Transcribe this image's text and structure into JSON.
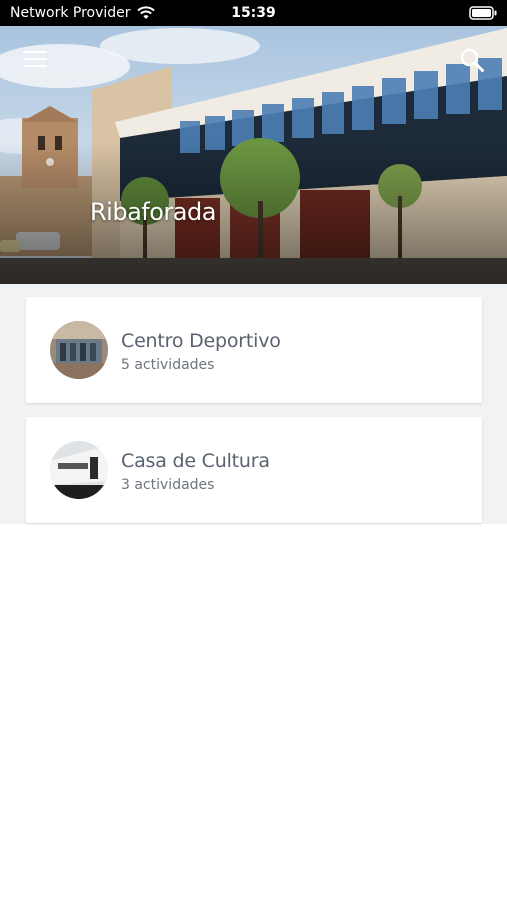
{
  "status_bar": {
    "carrier": "Network Provider",
    "time": "15:39"
  },
  "header": {
    "title": "Ribaforada",
    "menu_icon": "hamburger-menu-icon",
    "search_icon": "search-icon"
  },
  "venues": [
    {
      "name": "Centro Deportivo",
      "activities": "5 actividades",
      "image": "gym-interior-photo"
    },
    {
      "name": "Casa de Cultura",
      "activities": "3 actividades",
      "image": "building-photo"
    }
  ],
  "colors": {
    "status_bar_bg": "#000000",
    "content_bg": "#f1f2f3",
    "card_bg": "#ffffff",
    "title_text": "#5a6270",
    "subtitle_text": "#6d7480"
  }
}
